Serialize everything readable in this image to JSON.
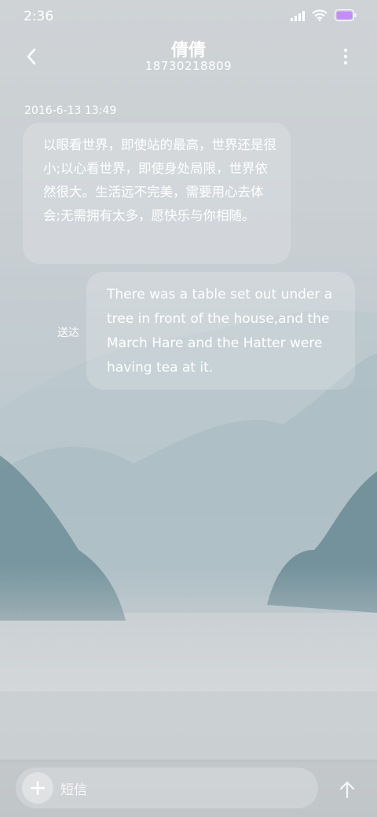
{
  "status_bar": {
    "time": "2:36"
  },
  "header": {
    "contact_name": "倩倩",
    "phone_number": "18730218809"
  },
  "conversation": {
    "timestamp": "2016-6-13 13:49",
    "incoming_message": "以眼看世界，即使站的最高，世界还是很小;以心看世界，即使身处局限，世界依然很大。生活远不完美，需要用心去体会;无需拥有太多，愿快乐与你相随。",
    "outgoing_message": "There was a table set out under a tree in front of the house,and the March Hare and the Hatter were having tea at it.",
    "sent_status": "送达"
  },
  "composer": {
    "placeholder": "短信"
  },
  "icons": {
    "back": "chevron-left-icon",
    "more": "more-vertical-icon",
    "add": "plus-icon",
    "send": "arrow-up-icon",
    "signal": "signal-icon",
    "wifi": "wifi-icon",
    "battery": "battery-icon"
  },
  "colors": {
    "text": "#ffffff",
    "battery_fill": "#c48cff"
  }
}
